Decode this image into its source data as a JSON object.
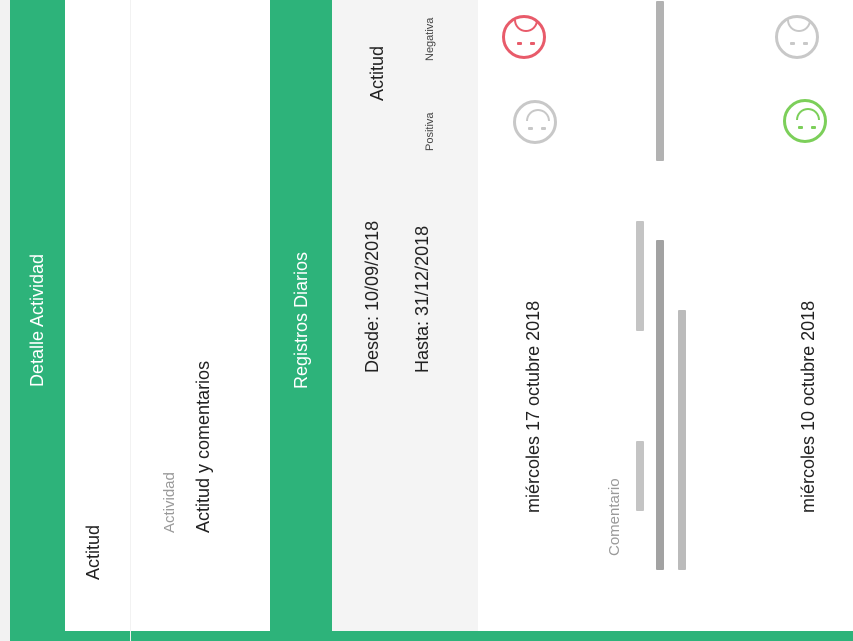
{
  "detail_header": "Detalle Actividad",
  "activity_name": "Actitud",
  "activity_label": "Actividad",
  "activity_value": "Actitud y comentarios",
  "records_header": "Registros Diarios",
  "range": {
    "from": "Desde: 10/09/2018",
    "to": "Hasta: 31/12/2018"
  },
  "legend": {
    "title": "Actitud",
    "positive": "Positiva",
    "negative": "Negativa"
  },
  "entries": [
    {
      "date": "miércoles 17 octubre 2018",
      "comment_label": "Comentario",
      "selected": "negative"
    },
    {
      "date": "miércoles 10 octubre 2018",
      "selected": "positive"
    }
  ],
  "colors": {
    "accent": "#2db37a",
    "negative": "#e85b6a",
    "positive": "#7ccf5a",
    "neutral": "#c8c8c8"
  }
}
